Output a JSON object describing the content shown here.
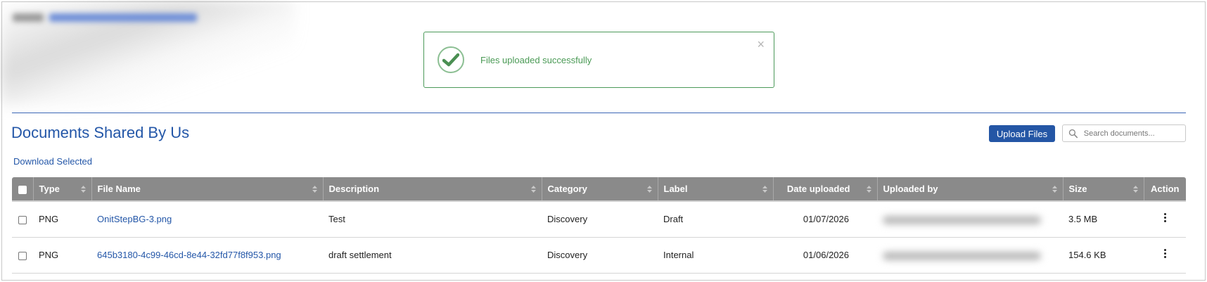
{
  "alert": {
    "message": "Files uploaded successfully",
    "close_label": "×"
  },
  "page": {
    "title": "Documents Shared By Us",
    "upload_label": "Upload Files",
    "search_placeholder": "Search documents...",
    "download_selected_label": "Download Selected"
  },
  "table": {
    "columns": {
      "type": "Type",
      "file_name": "File Name",
      "description": "Description",
      "category": "Category",
      "label": "Label",
      "date_uploaded": "Date uploaded",
      "uploaded_by": "Uploaded by",
      "size": "Size",
      "action": "Action"
    },
    "rows": [
      {
        "type": "PNG",
        "file_name": "OnitStepBG-3.png",
        "description": "Test",
        "category": "Discovery",
        "label": "Draft",
        "date_uploaded": "01/07/2026",
        "size": "3.5 MB"
      },
      {
        "type": "PNG",
        "file_name": "645b3180-4c99-46cd-8e44-32fd77f8f953.png",
        "description": "draft settlement",
        "category": "Discovery",
        "label": "Internal",
        "date_uploaded": "01/06/2026",
        "size": "154.6 KB"
      }
    ]
  },
  "colors": {
    "primary": "#2457a8",
    "success": "#4a9a55",
    "header_bg": "#8a8a8a"
  }
}
